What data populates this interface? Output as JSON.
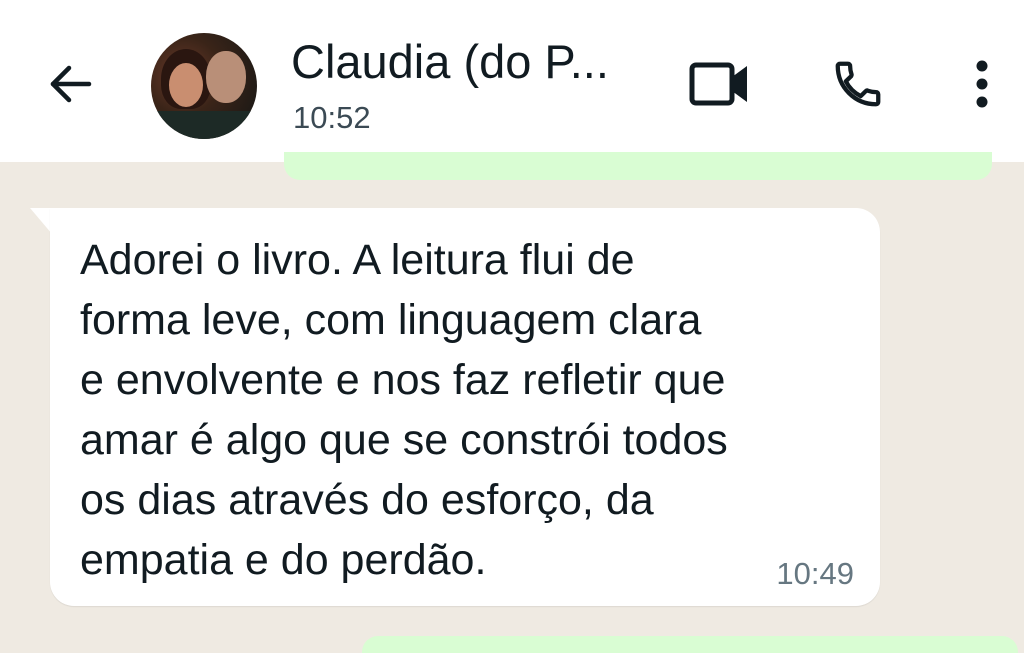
{
  "header": {
    "contact_name": "Claudia (do P...",
    "status": "10:52",
    "icons": {
      "back": "arrow-left-icon",
      "video": "video-camera-icon",
      "call": "phone-icon",
      "menu": "vertical-dots-icon"
    }
  },
  "message": {
    "lines": [
      "Adorei o livro. A leitura flui de",
      "forma leve, com linguagem clara",
      "e envolvente e nos faz refletir que",
      "amar é algo que se constrói todos",
      "os dias através do esforço, da",
      "empatia e do perdão."
    ],
    "time": "10:49"
  },
  "colors": {
    "header_bg": "#ffffff",
    "chat_bg": "#efeae2",
    "incoming_bubble": "#ffffff",
    "outgoing_bubble": "#d9fdd3",
    "text_primary": "#111b21",
    "text_secondary": "#667781"
  }
}
